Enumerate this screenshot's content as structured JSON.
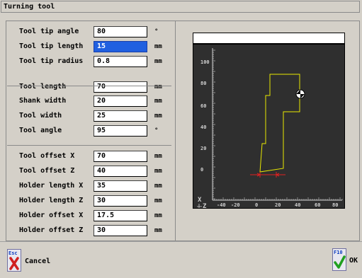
{
  "window": {
    "title": "Turning tool"
  },
  "fields": [
    {
      "label": "Tool tip angle",
      "value": "80",
      "unit": "°"
    },
    {
      "label": "Tool tip length",
      "value": "15",
      "unit": "mm",
      "selected": true
    },
    {
      "label": "Tool tip radius",
      "value": "0.8",
      "unit": "mm"
    },
    {
      "label": "Tool length",
      "value": "70",
      "unit": "mm"
    },
    {
      "label": "Shank width",
      "value": "20",
      "unit": "mm"
    },
    {
      "label": "Tool width",
      "value": "25",
      "unit": "mm"
    },
    {
      "label": "Tool angle",
      "value": "95",
      "unit": "°"
    },
    {
      "label": "Tool offset X",
      "value": "70",
      "unit": "mm"
    },
    {
      "label": "Tool offset Z",
      "value": "40",
      "unit": "mm"
    },
    {
      "label": "Holder length X",
      "value": "35",
      "unit": "mm"
    },
    {
      "label": "Holder length Z",
      "value": "30",
      "unit": "mm"
    },
    {
      "label": "Holder offset X",
      "value": "17.5",
      "unit": "mm"
    },
    {
      "label": "Holder offset Z",
      "value": "30",
      "unit": "mm"
    }
  ],
  "plot": {
    "y_ticks": [
      "100",
      "80",
      "60",
      "40",
      "20",
      "0"
    ],
    "x_ticks": [
      "-40",
      "-20",
      "0",
      "20",
      "40",
      "60",
      "80"
    ],
    "axis_x": "X",
    "axis_z": "Z",
    "colors": {
      "background": "#2f2f2f",
      "tool": "#e8e800",
      "dimension": "#e02020",
      "axes": "#d0d0d0"
    }
  },
  "buttons": {
    "cancel": {
      "key": "Esc",
      "label": "Cancel",
      "icon": "cross-icon"
    },
    "ok": {
      "key": "F10",
      "label": "OK",
      "icon": "checkmark-icon"
    }
  }
}
